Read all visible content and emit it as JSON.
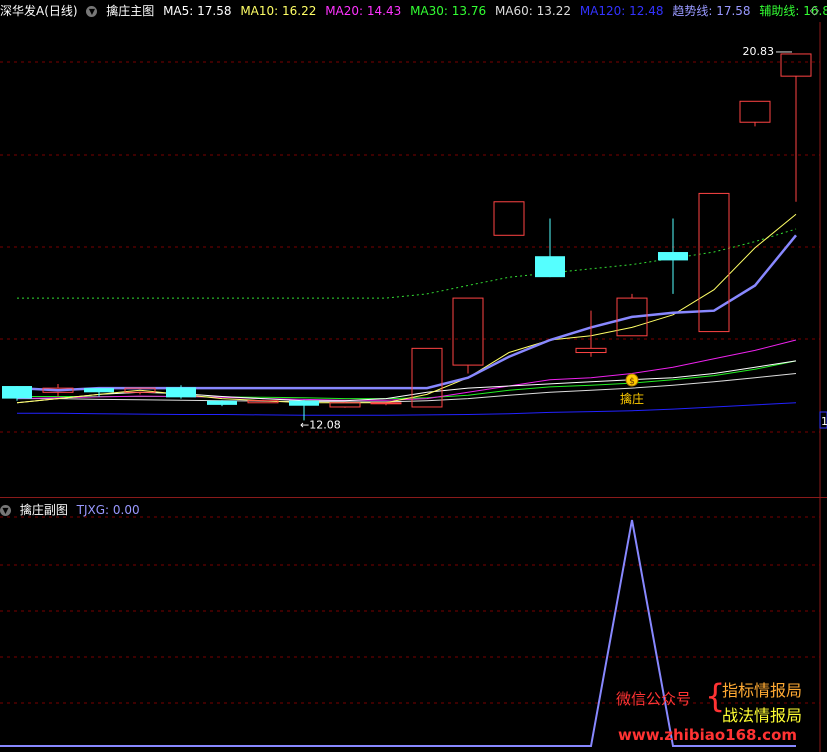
{
  "main_header": {
    "stock": "深华发A(日线)",
    "indicator": "擒庄主图",
    "ma5": {
      "label": "MA5: 17.58",
      "color": "#ffffff"
    },
    "ma10": {
      "label": "MA10: 16.22",
      "color": "#ffff66"
    },
    "ma20": {
      "label": "MA20: 14.43",
      "color": "#ff33ff"
    },
    "ma30": {
      "label": "MA30: 13.76",
      "color": "#33ff33"
    },
    "ma60": {
      "label": "MA60: 13.22",
      "color": "#dddddd"
    },
    "ma120": {
      "label": "MA120: 12.48",
      "color": "#3333ff"
    },
    "trend": {
      "label": "趋势线: 17.58",
      "color": "#9999ff"
    },
    "aux": {
      "label": "辅助线: 16.80",
      "color": "#33ff33"
    }
  },
  "sub_header": {
    "indicator": "擒庄副图",
    "tjxg": {
      "label": "TJXG: 0.00",
      "color": "#9999ff"
    }
  },
  "annotations": {
    "high_price": "20.83",
    "low_price": "12.08",
    "signal_label": "擒庄",
    "right_edge_label": "1"
  },
  "watermark": {
    "left": "微信公众号",
    "brace": "{",
    "right_top": "指标情报局",
    "right_bottom": "战法情报局",
    "url": "www.zhibiao168.com"
  },
  "colors": {
    "up": "#ff4444",
    "down": "#55ffff",
    "grid": "#7a0000",
    "trend": "#8888ff"
  },
  "chart_data": {
    "type": "candlestick",
    "candles": [
      {
        "open": 12.9,
        "close": 12.6,
        "high": 12.9,
        "low": 12.55
      },
      {
        "open": 12.75,
        "close": 12.85,
        "high": 12.95,
        "low": 12.65
      },
      {
        "open": 12.85,
        "close": 12.75,
        "high": 12.85,
        "low": 12.65
      },
      {
        "open": 12.75,
        "close": 12.85,
        "high": 12.85,
        "low": 12.7
      },
      {
        "open": 12.87,
        "close": 12.63,
        "high": 12.92,
        "low": 12.6
      },
      {
        "open": 12.55,
        "close": 12.45,
        "high": 12.56,
        "low": 12.42
      },
      {
        "open": 12.5,
        "close": 12.55,
        "high": 12.57,
        "low": 12.5
      },
      {
        "open": 12.55,
        "close": 12.43,
        "high": 12.57,
        "low": 12.08
      },
      {
        "open": 12.4,
        "close": 12.5,
        "high": 12.52,
        "low": 12.38
      },
      {
        "open": 12.5,
        "close": 12.5,
        "high": 12.5,
        "low": 12.44
      },
      {
        "open": 12.4,
        "close": 13.8,
        "high": 13.8,
        "low": 12.4
      },
      {
        "open": 13.4,
        "close": 15.0,
        "high": 15.0,
        "low": 13.2
      },
      {
        "open": 16.5,
        "close": 17.3,
        "high": 17.3,
        "low": 16.5
      },
      {
        "open": 16.0,
        "close": 15.5,
        "high": 16.9,
        "low": 15.5
      },
      {
        "open": 13.7,
        "close": 13.8,
        "high": 14.7,
        "low": 13.6
      },
      {
        "open": 14.1,
        "close": 15.0,
        "high": 15.1,
        "low": 14.1
      },
      {
        "open": 16.1,
        "close": 15.9,
        "high": 16.9,
        "low": 15.1
      },
      {
        "open": 14.2,
        "close": 17.5,
        "high": 17.5,
        "low": 14.2
      },
      {
        "open": 19.2,
        "close": 19.7,
        "high": 19.7,
        "low": 19.1
      },
      {
        "open": 20.3,
        "close": 20.83,
        "high": 20.83,
        "low": 17.3
      }
    ],
    "lines": {
      "trend": [
        12.85,
        12.8,
        12.85,
        12.85,
        12.85,
        12.85,
        12.85,
        12.85,
        12.85,
        12.85,
        12.85,
        13.1,
        13.6,
        14.0,
        14.3,
        14.55,
        14.65,
        14.7,
        15.3,
        16.5
      ],
      "ma5": [
        12.5,
        12.6,
        12.7,
        12.8,
        12.7,
        12.6,
        12.55,
        12.5,
        12.5,
        12.5,
        12.7,
        13.1,
        13.7,
        14.0,
        14.1,
        14.3,
        14.6,
        15.2,
        16.2,
        17.0
      ],
      "ma20": [
        12.6,
        12.62,
        12.64,
        12.66,
        12.65,
        12.63,
        12.6,
        12.58,
        12.56,
        12.56,
        12.6,
        12.75,
        12.9,
        13.05,
        13.1,
        13.2,
        13.35,
        13.55,
        13.75,
        14.0
      ],
      "ma30": [
        12.65,
        12.65,
        12.65,
        12.65,
        12.65,
        12.64,
        12.63,
        12.62,
        12.6,
        12.6,
        12.62,
        12.68,
        12.8,
        12.88,
        12.92,
        12.97,
        13.05,
        13.15,
        13.3,
        13.5
      ],
      "ma60": [
        12.6,
        12.6,
        12.58,
        12.57,
        12.56,
        12.55,
        12.54,
        12.53,
        12.52,
        12.52,
        12.55,
        12.6,
        12.68,
        12.75,
        12.8,
        12.85,
        12.92,
        13.0,
        13.1,
        13.2
      ],
      "ma120": [
        12.25,
        12.25,
        12.24,
        12.23,
        12.22,
        12.22,
        12.21,
        12.2,
        12.2,
        12.2,
        12.21,
        12.22,
        12.24,
        12.27,
        12.29,
        12.31,
        12.35,
        12.4,
        12.45,
        12.5
      ],
      "aux": [
        15.0,
        15.0,
        15.0,
        15.0,
        15.0,
        15.0,
        15.0,
        15.0,
        15.0,
        15.0,
        15.1,
        15.3,
        15.5,
        15.6,
        15.7,
        15.8,
        15.95,
        16.1,
        16.35,
        16.65
      ],
      "white": [
        12.5,
        12.6,
        12.7,
        12.75,
        12.72,
        12.65,
        12.6,
        12.55,
        12.55,
        12.6,
        12.75,
        12.85,
        12.9,
        12.95,
        13.0,
        13.05,
        13.1,
        13.2,
        13.35,
        13.5
      ]
    },
    "tjxg": [
      0,
      0,
      0,
      0,
      0,
      0,
      0,
      0,
      0,
      0,
      0,
      0,
      0,
      0,
      0,
      1,
      0,
      0,
      0,
      0
    ],
    "y_min": 11.85,
    "y_max": 21.45
  }
}
